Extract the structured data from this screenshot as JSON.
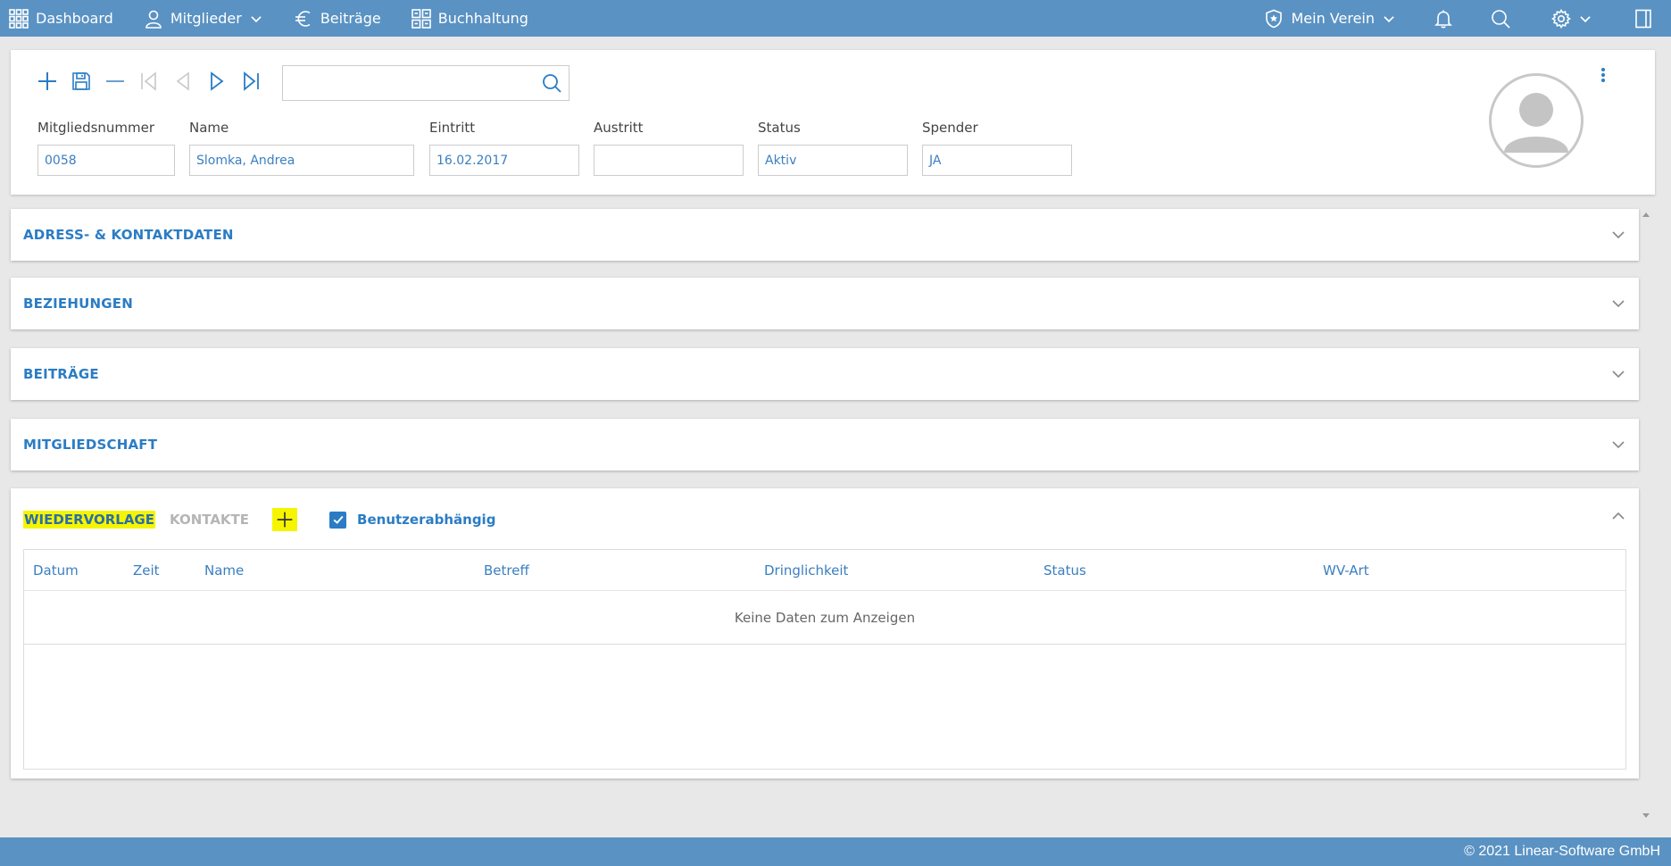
{
  "nav": {
    "dashboard": "Dashboard",
    "mitglieder": "Mitglieder",
    "beitraege": "Beiträge",
    "buchhaltung": "Buchhaltung",
    "verein": "Mein Verein"
  },
  "search": {
    "value": "",
    "placeholder": ""
  },
  "member": {
    "fields": [
      {
        "label": "Mitgliedsnummer",
        "value": "0058"
      },
      {
        "label": "Name",
        "value": "Slomka, Andrea"
      },
      {
        "label": "Eintritt",
        "value": "16.02.2017"
      },
      {
        "label": "Austritt",
        "value": ""
      },
      {
        "label": "Status",
        "value": "Aktiv"
      },
      {
        "label": "Spender",
        "value": "JA"
      }
    ]
  },
  "sections": {
    "adress": "ADRESS- & KONTAKTDATEN",
    "beziehungen": "BEZIEHUNGEN",
    "beitraege": "BEITRÄGE",
    "mitgliedschaft": "MITGLIEDSCHAFT"
  },
  "wiedervorlage": {
    "tab_active": "WIEDERVORLAGE",
    "tab_kontakte": "KONTAKTE",
    "checkbox_label": "Benutzerabhängig",
    "checked": true,
    "columns": [
      "Datum",
      "Zeit",
      "Name",
      "Betreff",
      "Dringlichkeit",
      "Status",
      "WV-Art"
    ],
    "empty_text": "Keine Daten zum Anzeigen"
  },
  "footer": {
    "copyright": "© 2021 Linear-Software GmbH"
  },
  "colors": {
    "nav_bg": "#5a92c3",
    "accent": "#2b7cc4",
    "highlight": "#f5f500"
  }
}
